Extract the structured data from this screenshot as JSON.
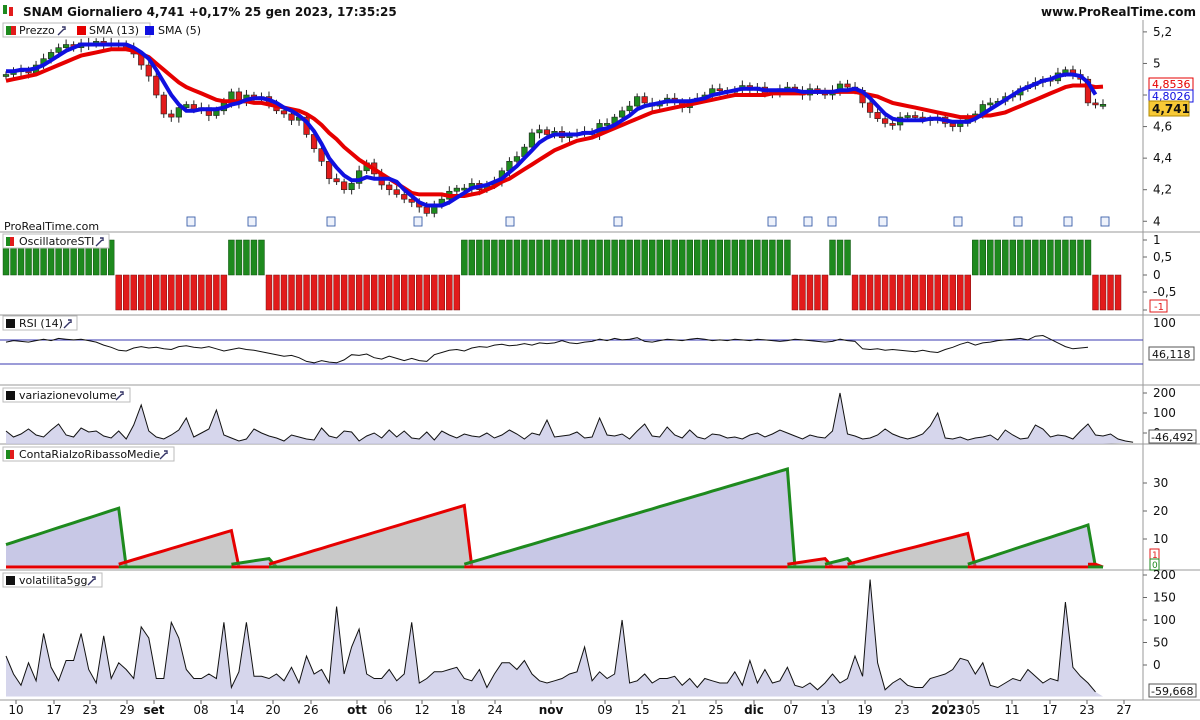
{
  "header": {
    "title": "SNAM Giornaliero 4,741 +0,17% 25 gen 2023, 17:35:25",
    "site": "www.ProRealTime.com"
  },
  "watermark": "ProRealTime.com",
  "colors": {
    "up": "#1e8a1e",
    "down": "#e21b1b",
    "sma13": "#e60000",
    "sma5": "#1010e0",
    "fill": "#c8c8e6",
    "axisbg": "#ffffff"
  },
  "price_panel": {
    "legend": [
      {
        "label": "Prezzo",
        "color": "#1e8a1e"
      },
      {
        "label": "SMA (13)",
        "color": "#e60000"
      },
      {
        "label": "SMA (5)",
        "color": "#1010e0"
      }
    ],
    "ticks": [
      "5,2",
      "5",
      "4,8",
      "4,6",
      "4,4",
      "4,2",
      "4"
    ],
    "tags": {
      "sma13": "4,8536",
      "sma5": "4,8026",
      "last": "4,741"
    }
  },
  "sti_panel": {
    "legend": "OscillatoreSTI",
    "ticks": [
      "1",
      "0,5",
      "0",
      "-0,5",
      "-1"
    ],
    "tag": "-1"
  },
  "rsi_panel": {
    "legend": "RSI (14)",
    "ticks": [
      "100"
    ],
    "tag": "46,118"
  },
  "vol_panel": {
    "legend": "variazionevolume",
    "ticks": [
      "200",
      "100",
      "0"
    ],
    "tag": "-46,492"
  },
  "conta_panel": {
    "legend": "ContaRialzoRibassoMedie",
    "ticks": [
      "30",
      "20",
      "10"
    ],
    "tags": [
      "1",
      "0"
    ]
  },
  "volat_panel": {
    "legend": "volatilita5gg",
    "ticks": [
      "200",
      "150",
      "100",
      "50",
      "0"
    ],
    "tag": "-59,668"
  },
  "x_axis": [
    {
      "label": "10",
      "bold": false
    },
    {
      "label": "17",
      "bold": false
    },
    {
      "label": "23",
      "bold": false
    },
    {
      "label": "29",
      "bold": false
    },
    {
      "label": "set",
      "bold": true
    },
    {
      "label": "08",
      "bold": false
    },
    {
      "label": "14",
      "bold": false
    },
    {
      "label": "20",
      "bold": false
    },
    {
      "label": "26",
      "bold": false
    },
    {
      "label": "ott",
      "bold": true
    },
    {
      "label": "06",
      "bold": false
    },
    {
      "label": "12",
      "bold": false
    },
    {
      "label": "18",
      "bold": false
    },
    {
      "label": "24",
      "bold": false
    },
    {
      "label": "nov",
      "bold": true
    },
    {
      "label": "09",
      "bold": false
    },
    {
      "label": "15",
      "bold": false
    },
    {
      "label": "21",
      "bold": false
    },
    {
      "label": "25",
      "bold": false
    },
    {
      "label": "dic",
      "bold": true
    },
    {
      "label": "07",
      "bold": false
    },
    {
      "label": "13",
      "bold": false
    },
    {
      "label": "19",
      "bold": false
    },
    {
      "label": "23",
      "bold": false
    },
    {
      "label": "2023",
      "bold": true
    },
    {
      "label": "05",
      "bold": false
    },
    {
      "label": "11",
      "bold": false
    },
    {
      "label": "17",
      "bold": false
    },
    {
      "label": "23",
      "bold": false
    },
    {
      "label": "27",
      "bold": false
    }
  ],
  "chart_data": {
    "type": "line",
    "title": "SNAM Giornaliero 4,741 +0,17% 25 gen 2023, 17:35:25",
    "xlabel": "",
    "ylabel": "",
    "ylim": [
      3.97,
      5.25
    ],
    "close": [
      4.93,
      4.95,
      4.96,
      4.94,
      4.99,
      5.03,
      5.07,
      5.1,
      5.12,
      5.1,
      5.13,
      5.12,
      5.14,
      5.11,
      5.13,
      5.12,
      5.1,
      5.06,
      4.99,
      4.92,
      4.8,
      4.68,
      4.66,
      4.72,
      4.74,
      4.71,
      4.72,
      4.67,
      4.7,
      4.75,
      4.82,
      4.75,
      4.8,
      4.77,
      4.79,
      4.75,
      4.7,
      4.68,
      4.64,
      4.66,
      4.55,
      4.46,
      4.38,
      4.27,
      4.25,
      4.2,
      4.24,
      4.32,
      4.37,
      4.3,
      4.23,
      4.2,
      4.17,
      4.14,
      4.12,
      4.09,
      4.05,
      4.11,
      4.14,
      4.19,
      4.21,
      4.21,
      4.24,
      4.2,
      4.23,
      4.25,
      4.32,
      4.38,
      4.41,
      4.47,
      4.56,
      4.58,
      4.55,
      4.57,
      4.53,
      4.55,
      4.56,
      4.57,
      4.55,
      4.62,
      4.62,
      4.66,
      4.7,
      4.73,
      4.79,
      4.75,
      4.73,
      4.75,
      4.78,
      4.76,
      4.72,
      4.76,
      4.78,
      4.8,
      4.84,
      4.83,
      4.82,
      4.83,
      4.86,
      4.83,
      4.85,
      4.81,
      4.82,
      4.84,
      4.85,
      4.83,
      4.8,
      4.84,
      4.82,
      4.8,
      4.83,
      4.87,
      4.85,
      4.83,
      4.75,
      4.69,
      4.65,
      4.62,
      4.61,
      4.66,
      4.67,
      4.66,
      4.65,
      4.64,
      4.66,
      4.62,
      4.6,
      4.62,
      4.65,
      4.68,
      4.74,
      4.75,
      4.76,
      4.79,
      4.8,
      4.84,
      4.86,
      4.88,
      4.9,
      4.89,
      4.94,
      4.96,
      4.93,
      4.9,
      4.75,
      4.74,
      4.741
    ],
    "sma13": [
      4.89,
      4.9,
      4.91,
      4.92,
      4.93,
      4.95,
      4.97,
      4.99,
      5.01,
      5.03,
      5.05,
      5.06,
      5.07,
      5.08,
      5.09,
      5.09,
      5.09,
      5.08,
      5.06,
      5.04,
      5.0,
      4.96,
      4.92,
      4.88,
      4.85,
      4.83,
      4.81,
      4.79,
      4.77,
      4.76,
      4.76,
      4.76,
      4.76,
      4.75,
      4.75,
      4.74,
      4.73,
      4.72,
      4.71,
      4.7,
      4.68,
      4.65,
      4.61,
      4.56,
      4.52,
      4.47,
      4.43,
      4.39,
      4.36,
      4.33,
      4.3,
      4.27,
      4.24,
      4.21,
      4.18,
      4.17,
      4.17,
      4.17,
      4.17,
      4.16,
      4.16,
      4.16,
      4.17,
      4.18,
      4.2,
      4.22,
      4.25,
      4.27,
      4.3,
      4.33,
      4.36,
      4.39,
      4.42,
      4.45,
      4.47,
      4.49,
      4.51,
      4.52,
      4.53,
      4.55,
      4.57,
      4.59,
      4.61,
      4.63,
      4.65,
      4.67,
      4.69,
      4.7,
      4.71,
      4.72,
      4.73,
      4.74,
      4.75,
      4.76,
      4.77,
      4.78,
      4.79,
      4.8,
      4.8,
      4.8,
      4.8,
      4.8,
      4.81,
      4.81,
      4.81,
      4.81,
      4.81,
      4.82,
      4.82,
      4.82,
      4.82,
      4.82,
      4.82,
      4.82,
      4.81,
      4.8,
      4.79,
      4.77,
      4.75,
      4.74,
      4.73,
      4.72,
      4.71,
      4.7,
      4.69,
      4.68,
      4.67,
      4.66,
      4.66,
      4.66,
      4.67,
      4.67,
      4.68,
      4.69,
      4.71,
      4.73,
      4.75,
      4.77,
      4.79,
      4.81,
      4.83,
      4.85,
      4.86,
      4.86,
      4.86,
      4.85,
      4.8536
    ],
    "sma5": [
      4.95,
      4.95,
      4.96,
      4.96,
      4.97,
      4.99,
      5.02,
      5.05,
      5.08,
      5.1,
      5.12,
      5.12,
      5.12,
      5.12,
      5.12,
      5.12,
      5.12,
      5.1,
      5.07,
      5.03,
      4.96,
      4.88,
      4.8,
      4.74,
      4.7,
      4.7,
      4.71,
      4.71,
      4.71,
      4.72,
      4.74,
      4.75,
      4.77,
      4.78,
      4.78,
      4.77,
      4.75,
      4.72,
      4.7,
      4.67,
      4.63,
      4.57,
      4.49,
      4.4,
      4.34,
      4.29,
      4.26,
      4.26,
      4.28,
      4.27,
      4.27,
      4.27,
      4.25,
      4.2,
      4.16,
      4.12,
      4.1,
      4.1,
      4.1,
      4.12,
      4.15,
      4.18,
      4.21,
      4.22,
      4.23,
      4.25,
      4.27,
      4.31,
      4.35,
      4.4,
      4.45,
      4.5,
      4.53,
      4.55,
      4.55,
      4.55,
      4.55,
      4.56,
      4.56,
      4.58,
      4.59,
      4.61,
      4.64,
      4.67,
      4.71,
      4.73,
      4.74,
      4.75,
      4.76,
      4.76,
      4.76,
      4.76,
      4.77,
      4.78,
      4.8,
      4.81,
      4.82,
      4.83,
      4.84,
      4.84,
      4.84,
      4.83,
      4.83,
      4.83,
      4.83,
      4.83,
      4.82,
      4.82,
      4.82,
      4.82,
      4.82,
      4.83,
      4.83,
      4.84,
      4.82,
      4.78,
      4.73,
      4.68,
      4.65,
      4.64,
      4.64,
      4.64,
      4.64,
      4.65,
      4.65,
      4.64,
      4.63,
      4.63,
      4.63,
      4.65,
      4.68,
      4.71,
      4.74,
      4.77,
      4.8,
      4.83,
      4.85,
      4.87,
      4.89,
      4.9,
      4.92,
      4.93,
      4.93,
      4.92,
      4.88,
      4.8026
    ],
    "sti": [
      1,
      1,
      1,
      1,
      1,
      1,
      1,
      1,
      1,
      1,
      1,
      1,
      1,
      1,
      1,
      -1,
      -1,
      -1,
      -1,
      -1,
      -1,
      -1,
      -1,
      -1,
      -1,
      -1,
      -1,
      -1,
      -1,
      -1,
      1,
      1,
      1,
      1,
      1,
      -1,
      -1,
      -1,
      -1,
      -1,
      -1,
      -1,
      -1,
      -1,
      -1,
      -1,
      -1,
      -1,
      -1,
      -1,
      -1,
      -1,
      -1,
      -1,
      -1,
      -1,
      -1,
      -1,
      -1,
      -1,
      -1,
      1,
      1,
      1,
      1,
      1,
      1,
      1,
      1,
      1,
      1,
      1,
      1,
      1,
      1,
      1,
      1,
      1,
      1,
      1,
      1,
      1,
      1,
      1,
      1,
      1,
      1,
      1,
      1,
      1,
      1,
      1,
      1,
      1,
      1,
      1,
      1,
      1,
      1,
      1,
      1,
      1,
      1,
      1,
      1,
      -1,
      -1,
      -1,
      -1,
      -1,
      1,
      1,
      1,
      -1,
      -1,
      -1,
      -1,
      -1,
      -1,
      -1,
      -1,
      -1,
      -1,
      -1,
      -1,
      -1,
      -1,
      -1,
      -1,
      1,
      1,
      1,
      1,
      1,
      1,
      1,
      1,
      1,
      1,
      1,
      1,
      1,
      1,
      1,
      1,
      -1,
      -1,
      -1,
      -1
    ],
    "rsi": [
      62,
      64,
      63,
      62,
      64,
      66,
      64,
      67,
      66,
      65,
      66,
      64,
      62,
      58,
      55,
      51,
      50,
      54,
      56,
      54,
      55,
      53,
      52,
      56,
      57,
      55,
      54,
      56,
      53,
      50,
      52,
      54,
      52,
      51,
      49,
      47,
      45,
      43,
      44,
      41,
      36,
      34,
      37,
      35,
      34,
      38,
      45,
      44,
      46,
      41,
      39,
      43,
      40,
      37,
      40,
      37,
      36,
      45,
      48,
      51,
      52,
      50,
      54,
      56,
      55,
      58,
      59,
      57,
      58,
      60,
      58,
      61,
      60,
      61,
      64,
      61,
      60,
      62,
      63,
      66,
      64,
      67,
      65,
      66,
      68,
      63,
      62,
      64,
      66,
      65,
      64,
      66,
      67,
      66,
      64,
      65,
      64,
      66,
      65,
      64,
      66,
      65,
      64,
      63,
      64,
      66,
      65,
      64,
      63,
      62,
      63,
      66,
      64,
      63,
      53,
      52,
      53,
      51,
      52,
      51,
      50,
      49,
      51,
      49,
      48,
      52,
      55,
      59,
      62,
      58,
      61,
      62,
      64,
      65,
      66,
      67,
      65,
      70,
      71,
      66,
      61,
      56,
      53,
      54,
      55
    ],
    "variazionevolume": [
      10,
      -20,
      -5,
      20,
      -10,
      -20,
      15,
      45,
      -10,
      -20,
      25,
      5,
      10,
      -15,
      -25,
      10,
      -30,
      40,
      140,
      10,
      -20,
      -30,
      -10,
      15,
      75,
      -20,
      0,
      20,
      115,
      -10,
      -25,
      -40,
      -30,
      20,
      0,
      -15,
      -25,
      -40,
      -10,
      -20,
      -30,
      -35,
      25,
      -15,
      -25,
      10,
      5,
      -40,
      -15,
      0,
      -25,
      15,
      -20,
      10,
      -25,
      -30,
      5,
      -35,
      10,
      -10,
      -25,
      -5,
      -15,
      -20,
      0,
      -25,
      -10,
      15,
      -5,
      -30,
      0,
      -10,
      65,
      -20,
      -15,
      -10,
      5,
      -25,
      -20,
      75,
      -10,
      -15,
      -5,
      -30,
      10,
      45,
      -15,
      -20,
      30,
      -10,
      -25,
      15,
      -20,
      -30,
      -5,
      -10,
      -25,
      -20,
      -30,
      -10,
      0,
      -20,
      -5,
      15,
      0,
      -15,
      -30,
      -10,
      -20,
      -25,
      10,
      200,
      -5,
      -15,
      -30,
      -25,
      -10,
      20,
      -5,
      -20,
      -30,
      -20,
      -5,
      35,
      100,
      -25,
      -30,
      -20,
      -35,
      -25,
      -20,
      -10,
      -35,
      15,
      -10,
      -30,
      -25,
      40,
      20,
      -20,
      -10,
      -15,
      -30,
      10,
      45,
      -10,
      -15,
      -5,
      -30,
      -40,
      -46.492
    ],
    "contarialzoribassomedie": [
      {
        "dir": "up",
        "from": 0,
        "to": 15,
        "start": 8,
        "end": 21
      },
      {
        "dir": "down",
        "from": 15,
        "to": 30,
        "start": 1,
        "end": 13
      },
      {
        "dir": "up",
        "from": 30,
        "to": 35,
        "start": 1,
        "end": 3
      },
      {
        "dir": "down",
        "from": 35,
        "to": 61,
        "start": 1,
        "end": 22
      },
      {
        "dir": "up",
        "from": 61,
        "to": 104,
        "start": 1,
        "end": 35
      },
      {
        "dir": "down",
        "from": 104,
        "to": 109,
        "start": 1,
        "end": 3
      },
      {
        "dir": "up",
        "from": 109,
        "to": 112,
        "start": 1,
        "end": 3
      },
      {
        "dir": "down",
        "from": 112,
        "to": 128,
        "start": 1,
        "end": 12
      },
      {
        "dir": "up",
        "from": 128,
        "to": 144,
        "start": 1,
        "end": 15
      },
      {
        "dir": "down",
        "from": 144,
        "to": 145,
        "start": 1,
        "end": 1
      }
    ],
    "volatilita5gg": [
      20,
      -20,
      -45,
      5,
      -35,
      70,
      -5,
      -35,
      10,
      10,
      70,
      -10,
      -40,
      65,
      -30,
      5,
      -10,
      -30,
      85,
      60,
      -30,
      -30,
      95,
      60,
      -10,
      -30,
      -30,
      -20,
      -30,
      95,
      -50,
      -15,
      95,
      -25,
      -25,
      -30,
      -20,
      -35,
      -5,
      -40,
      20,
      -20,
      -10,
      -40,
      130,
      -20,
      40,
      80,
      -20,
      -30,
      -30,
      -10,
      -35,
      -20,
      95,
      -40,
      -30,
      -15,
      -15,
      -10,
      -5,
      -30,
      -35,
      -10,
      -50,
      -20,
      5,
      5,
      -10,
      10,
      -20,
      -35,
      -40,
      -35,
      -30,
      -20,
      -15,
      40,
      -35,
      -15,
      -30,
      -20,
      100,
      -40,
      -35,
      -20,
      -40,
      -30,
      -30,
      -25,
      -45,
      -30,
      -50,
      -30,
      -35,
      -40,
      -40,
      -15,
      -45,
      10,
      -40,
      -10,
      -40,
      -35,
      -5,
      -45,
      -50,
      -40,
      -55,
      -40,
      -20,
      -40,
      -30,
      20,
      -25,
      190,
      5,
      -55,
      -40,
      -30,
      -45,
      -50,
      -50,
      -30,
      -25,
      -20,
      -10,
      15,
      10,
      -20,
      5,
      -45,
      -50,
      -40,
      -30,
      -35,
      -10,
      -25,
      -40,
      -30,
      -35,
      140,
      -5,
      -25,
      -40,
      -59.668
    ]
  }
}
